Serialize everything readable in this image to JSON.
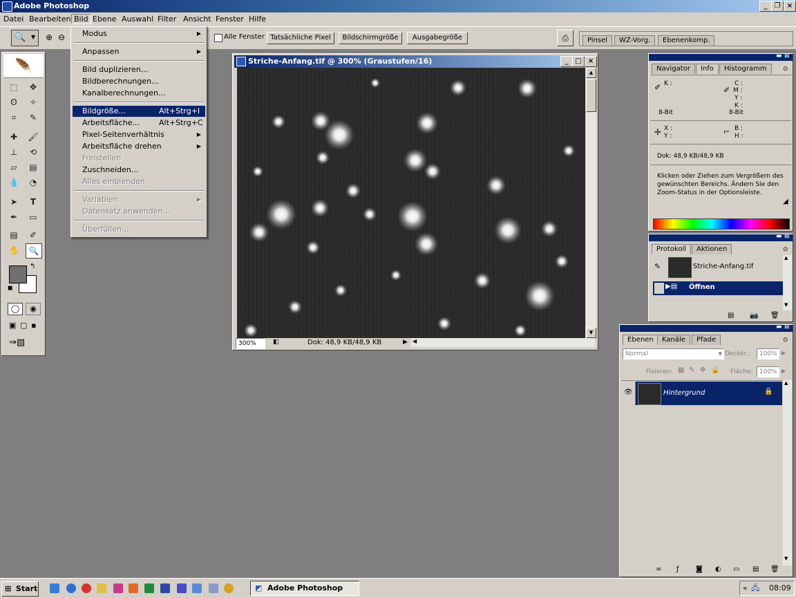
{
  "app": {
    "title": "Adobe Photoshop"
  },
  "menubar": [
    "Datei",
    "Bearbeiten",
    "Bild",
    "Ebene",
    "Auswahl",
    "Filter",
    "Ansicht",
    "Fenster",
    "Hilfe"
  ],
  "options_bar": {
    "checkbox_label": "Alle Fenster",
    "buttons": [
      "Tatsächliche Pixel",
      "Bildschirmgröße",
      "Ausgabegröße"
    ],
    "palette_tabs": [
      "Pinsel",
      "WZ-Vorg.",
      "Ebenenkomp."
    ]
  },
  "bild_menu": {
    "items": [
      {
        "label": "Modus",
        "submenu": true
      },
      {
        "label": "Anpassen",
        "submenu": true
      },
      {
        "label": "Bild duplizieren..."
      },
      {
        "label": "Bildberechnungen..."
      },
      {
        "label": "Kanalberechnungen..."
      },
      {
        "label": "Bildgröße...",
        "shortcut": "Alt+Strg+I",
        "highlighted": true
      },
      {
        "label": "Arbeitsfläche...",
        "shortcut": "Alt+Strg+C"
      },
      {
        "label": "Pixel-Seitenverhältnis",
        "submenu": true
      },
      {
        "label": "Arbeitsfläche drehen",
        "submenu": true
      },
      {
        "label": "Freistellen",
        "disabled": true
      },
      {
        "label": "Zuschneiden..."
      },
      {
        "label": "Alles einblenden",
        "disabled": true
      },
      {
        "label": "Variablen",
        "submenu": true,
        "disabled": true
      },
      {
        "label": "Datensatz anwenden...",
        "disabled": true
      },
      {
        "label": "Überfüllen...",
        "disabled": true
      }
    ]
  },
  "document": {
    "title": "Striche-Anfang.tif @ 300% (Graustufen/16)",
    "zoom": "300%",
    "status": "Dok: 48,9 KB/48,9 KB"
  },
  "info_panel": {
    "tabs": [
      "Navigator",
      "Info",
      "Histogramm"
    ],
    "k_label": "K :",
    "cmyk_labels": [
      "C :",
      "M :",
      "Y :",
      "K :"
    ],
    "bit_left": "8-Bit",
    "bit_right": "8-Bit",
    "xy_labels": [
      "X :",
      "Y :"
    ],
    "bh_labels": [
      "B :",
      "H :"
    ],
    "doc": "Dok: 48,9 KB/48,9 KB",
    "help": "Klicken oder Ziehen zum Vergrößern des gewünschten Bereichs. Ändern Sie den Zoom-Status in der Optionsleiste."
  },
  "history_panel": {
    "tabs": [
      "Protokoll",
      "Aktionen"
    ],
    "snapshot": "Striche-Anfang.tif",
    "step": "Öffnen"
  },
  "layers_panel": {
    "tabs": [
      "Ebenen",
      "Kanäle",
      "Pfade"
    ],
    "blend_mode": "Normal",
    "opacity_label": "Deckkr.:",
    "opacity": "100%",
    "lock_label": "Fixieren:",
    "fill_label": "Fläche:",
    "fill": "100%",
    "layer": "Hintergrund"
  },
  "taskbar": {
    "start": "Start",
    "task": "Adobe Photoshop",
    "clock": "08:09",
    "tray_prefix": "«"
  },
  "colors": {
    "title_blue": "#0a246a",
    "face": "#d4d0c8",
    "workspace": "#7f7f7f",
    "highlight": "#0a246a"
  }
}
